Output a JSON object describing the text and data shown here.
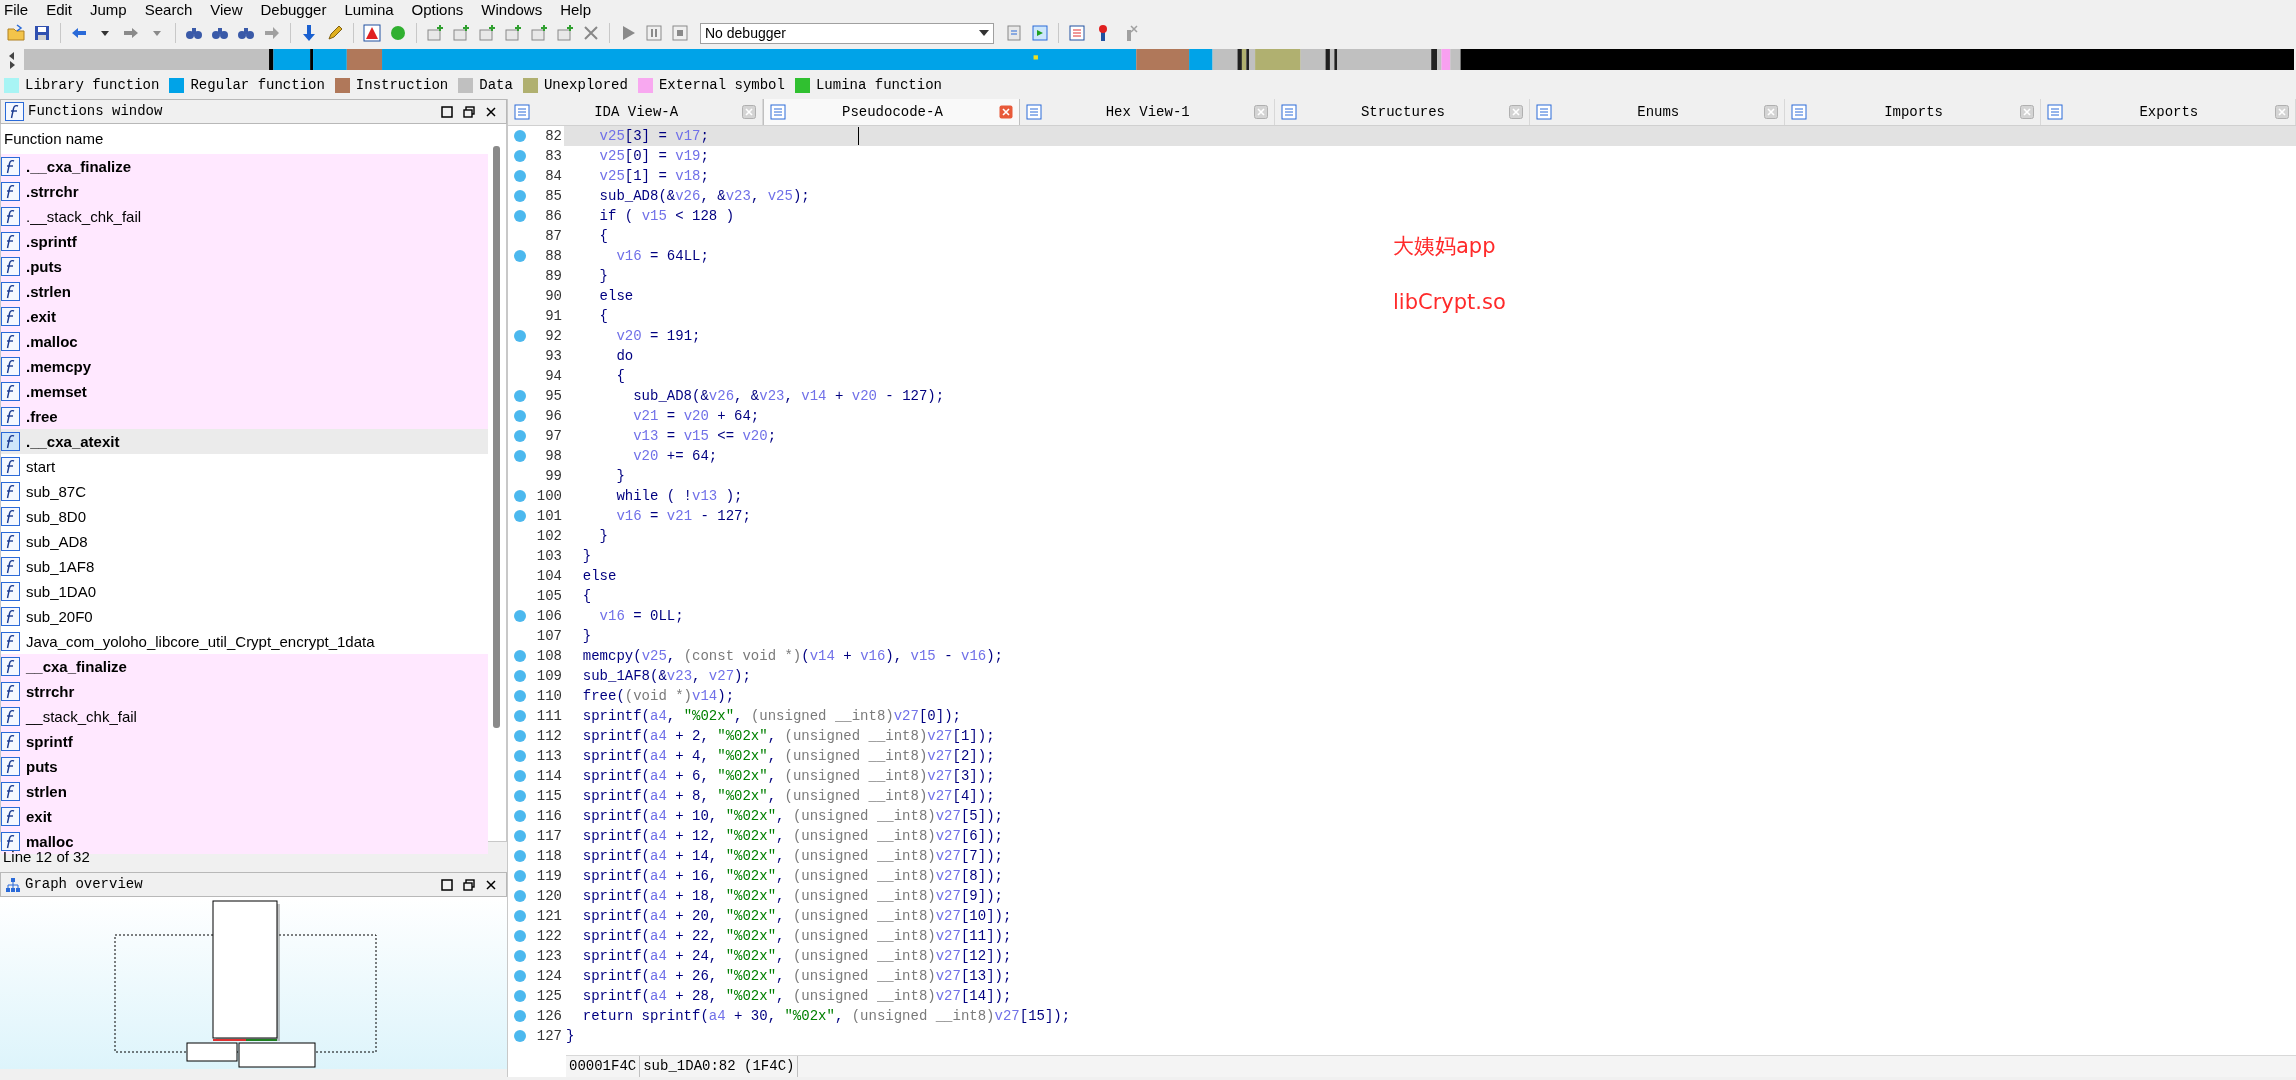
{
  "menu_bar": [
    "File",
    "Edit",
    "Jump",
    "Search",
    "View",
    "Debugger",
    "Lumina",
    "Options",
    "Windows",
    "Help"
  ],
  "toolbar": {
    "debugger": "No debugger"
  },
  "legend": [
    {
      "label": "Library function",
      "color": "#a8f4f4"
    },
    {
      "label": "Regular function",
      "color": "#00a3e8"
    },
    {
      "label": "Instruction",
      "color": "#b0785a"
    },
    {
      "label": "Data",
      "color": "#c0c0c0"
    },
    {
      "label": "Unexplored",
      "color": "#b0b070"
    },
    {
      "label": "External symbol",
      "color": "#f8a8f0"
    },
    {
      "label": "Lumina function",
      "color": "#30c030"
    }
  ],
  "functions_window": {
    "title": "Functions window",
    "column": "Function name",
    "items": [
      {
        "name": ".__cxa_finalize",
        "external": true,
        "bold": true,
        "selected": false
      },
      {
        "name": ".strrchr",
        "external": true,
        "bold": true,
        "selected": false
      },
      {
        "name": ".__stack_chk_fail",
        "external": true,
        "bold": false,
        "selected": false
      },
      {
        "name": ".sprintf",
        "external": true,
        "bold": true,
        "selected": false
      },
      {
        "name": ".puts",
        "external": true,
        "bold": true,
        "selected": false
      },
      {
        "name": ".strlen",
        "external": true,
        "bold": true,
        "selected": false
      },
      {
        "name": ".exit",
        "external": true,
        "bold": true,
        "selected": false
      },
      {
        "name": ".malloc",
        "external": true,
        "bold": true,
        "selected": false
      },
      {
        "name": ".memcpy",
        "external": true,
        "bold": true,
        "selected": false
      },
      {
        "name": ".memset",
        "external": true,
        "bold": true,
        "selected": false
      },
      {
        "name": ".free",
        "external": true,
        "bold": true,
        "selected": false
      },
      {
        "name": ".__cxa_atexit",
        "external": true,
        "bold": true,
        "selected": true
      },
      {
        "name": "start",
        "external": false,
        "bold": false,
        "selected": false
      },
      {
        "name": "sub_87C",
        "external": false,
        "bold": false,
        "selected": false
      },
      {
        "name": "sub_8D0",
        "external": false,
        "bold": false,
        "selected": false
      },
      {
        "name": "sub_AD8",
        "external": false,
        "bold": false,
        "selected": false
      },
      {
        "name": "sub_1AF8",
        "external": false,
        "bold": false,
        "selected": false
      },
      {
        "name": "sub_1DA0",
        "external": false,
        "bold": false,
        "selected": false
      },
      {
        "name": "sub_20F0",
        "external": false,
        "bold": false,
        "selected": false
      },
      {
        "name": "Java_com_yoloho_libcore_util_Crypt_encrypt_1data",
        "external": false,
        "bold": false,
        "selected": false
      },
      {
        "name": "__cxa_finalize",
        "external": true,
        "bold": true,
        "selected": false
      },
      {
        "name": "strrchr",
        "external": true,
        "bold": true,
        "selected": false
      },
      {
        "name": "__stack_chk_fail",
        "external": true,
        "bold": false,
        "selected": false
      },
      {
        "name": "sprintf",
        "external": true,
        "bold": true,
        "selected": false
      },
      {
        "name": "puts",
        "external": true,
        "bold": true,
        "selected": false
      },
      {
        "name": "strlen",
        "external": true,
        "bold": true,
        "selected": false
      },
      {
        "name": "exit",
        "external": true,
        "bold": true,
        "selected": false
      },
      {
        "name": "malloc",
        "external": true,
        "bold": true,
        "selected": false
      }
    ],
    "status": "Line 12 of 32"
  },
  "graph_overview": {
    "title": "Graph overview"
  },
  "tabs": [
    {
      "label": "IDA View-A",
      "selected": false
    },
    {
      "label": "Pseudocode-A",
      "selected": true
    },
    {
      "label": "Hex View-1",
      "selected": false
    },
    {
      "label": "Structures",
      "selected": false
    },
    {
      "label": "Enums",
      "selected": false
    },
    {
      "label": "Imports",
      "selected": false
    },
    {
      "label": "Exports",
      "selected": false
    }
  ],
  "pseudocode": {
    "lines": [
      {
        "number": "82",
        "dot": true,
        "selected": true,
        "segments": [
          {
            "kind": "var",
            "text": "    v25"
          },
          {
            "kind": "plain",
            "text": "[3] = "
          },
          {
            "kind": "var",
            "text": "v17"
          },
          {
            "kind": "plain",
            "text": ";"
          }
        ]
      },
      {
        "number": "83",
        "dot": true,
        "selected": false,
        "segments": [
          {
            "kind": "var",
            "text": "    v25"
          },
          {
            "kind": "plain",
            "text": "[0] = "
          },
          {
            "kind": "var",
            "text": "v19"
          },
          {
            "kind": "plain",
            "text": ";"
          }
        ]
      },
      {
        "number": "84",
        "dot": true,
        "selected": false,
        "segments": [
          {
            "kind": "var",
            "text": "    v25"
          },
          {
            "kind": "plain",
            "text": "[1] = "
          },
          {
            "kind": "var",
            "text": "v18"
          },
          {
            "kind": "plain",
            "text": ";"
          }
        ]
      },
      {
        "number": "85",
        "dot": true,
        "selected": false,
        "segments": [
          {
            "kind": "plain",
            "text": "    sub_AD8(&"
          },
          {
            "kind": "var",
            "text": "v26"
          },
          {
            "kind": "plain",
            "text": ", &"
          },
          {
            "kind": "var",
            "text": "v23"
          },
          {
            "kind": "plain",
            "text": ", "
          },
          {
            "kind": "var",
            "text": "v25"
          },
          {
            "kind": "plain",
            "text": ");"
          }
        ]
      },
      {
        "number": "86",
        "dot": true,
        "selected": false,
        "segments": [
          {
            "kind": "plain",
            "text": "    if ( "
          },
          {
            "kind": "var",
            "text": "v15"
          },
          {
            "kind": "plain",
            "text": " < 128 )"
          }
        ]
      },
      {
        "number": "87",
        "dot": false,
        "selected": false,
        "segments": [
          {
            "kind": "plain",
            "text": "    {"
          }
        ]
      },
      {
        "number": "88",
        "dot": true,
        "selected": false,
        "segments": [
          {
            "kind": "var",
            "text": "      v16"
          },
          {
            "kind": "plain",
            "text": " = 64LL;"
          }
        ]
      },
      {
        "number": "89",
        "dot": false,
        "selected": false,
        "segments": [
          {
            "kind": "plain",
            "text": "    }"
          }
        ]
      },
      {
        "number": "90",
        "dot": false,
        "selected": false,
        "segments": [
          {
            "kind": "plain",
            "text": "    else"
          }
        ]
      },
      {
        "number": "91",
        "dot": false,
        "selected": false,
        "segments": [
          {
            "kind": "plain",
            "text": "    {"
          }
        ]
      },
      {
        "number": "92",
        "dot": true,
        "selected": false,
        "segments": [
          {
            "kind": "var",
            "text": "      v20"
          },
          {
            "kind": "plain",
            "text": " = 191;"
          }
        ]
      },
      {
        "number": "93",
        "dot": false,
        "selected": false,
        "segments": [
          {
            "kind": "plain",
            "text": "      do"
          }
        ]
      },
      {
        "number": "94",
        "dot": false,
        "selected": false,
        "segments": [
          {
            "kind": "plain",
            "text": "      {"
          }
        ]
      },
      {
        "number": "95",
        "dot": true,
        "selected": false,
        "segments": [
          {
            "kind": "plain",
            "text": "        sub_AD8(&"
          },
          {
            "kind": "var",
            "text": "v26"
          },
          {
            "kind": "plain",
            "text": ", &"
          },
          {
            "kind": "var",
            "text": "v23"
          },
          {
            "kind": "plain",
            "text": ", "
          },
          {
            "kind": "var",
            "text": "v14"
          },
          {
            "kind": "plain",
            "text": " + "
          },
          {
            "kind": "var",
            "text": "v20"
          },
          {
            "kind": "plain",
            "text": " - 127);"
          }
        ]
      },
      {
        "number": "96",
        "dot": true,
        "selected": false,
        "segments": [
          {
            "kind": "var",
            "text": "        v21"
          },
          {
            "kind": "plain",
            "text": " = "
          },
          {
            "kind": "var",
            "text": "v20"
          },
          {
            "kind": "plain",
            "text": " + 64;"
          }
        ]
      },
      {
        "number": "97",
        "dot": true,
        "selected": false,
        "segments": [
          {
            "kind": "var",
            "text": "        v13"
          },
          {
            "kind": "plain",
            "text": " = "
          },
          {
            "kind": "var",
            "text": "v15"
          },
          {
            "kind": "plain",
            "text": " <= "
          },
          {
            "kind": "var",
            "text": "v20"
          },
          {
            "kind": "plain",
            "text": ";"
          }
        ]
      },
      {
        "number": "98",
        "dot": true,
        "selected": false,
        "segments": [
          {
            "kind": "var",
            "text": "        v20"
          },
          {
            "kind": "plain",
            "text": " += 64;"
          }
        ]
      },
      {
        "number": "99",
        "dot": false,
        "selected": false,
        "segments": [
          {
            "kind": "plain",
            "text": "      }"
          }
        ]
      },
      {
        "number": "100",
        "dot": true,
        "selected": false,
        "segments": [
          {
            "kind": "plain",
            "text": "      while ( !"
          },
          {
            "kind": "var",
            "text": "v13"
          },
          {
            "kind": "plain",
            "text": " );"
          }
        ]
      },
      {
        "number": "101",
        "dot": true,
        "selected": false,
        "segments": [
          {
            "kind": "var",
            "text": "      v16"
          },
          {
            "kind": "plain",
            "text": " = "
          },
          {
            "kind": "var",
            "text": "v21"
          },
          {
            "kind": "plain",
            "text": " - 127;"
          }
        ]
      },
      {
        "number": "102",
        "dot": false,
        "selected": false,
        "segments": [
          {
            "kind": "plain",
            "text": "    }"
          }
        ]
      },
      {
        "number": "103",
        "dot": false,
        "selected": false,
        "segments": [
          {
            "kind": "plain",
            "text": "  }"
          }
        ]
      },
      {
        "number": "104",
        "dot": false,
        "selected": false,
        "segments": [
          {
            "kind": "plain",
            "text": "  else"
          }
        ]
      },
      {
        "number": "105",
        "dot": false,
        "selected": false,
        "segments": [
          {
            "kind": "plain",
            "text": "  {"
          }
        ]
      },
      {
        "number": "106",
        "dot": true,
        "selected": false,
        "segments": [
          {
            "kind": "var",
            "text": "    v16"
          },
          {
            "kind": "plain",
            "text": " = 0LL;"
          }
        ]
      },
      {
        "number": "107",
        "dot": false,
        "selected": false,
        "segments": [
          {
            "kind": "plain",
            "text": "  }"
          }
        ]
      },
      {
        "number": "108",
        "dot": true,
        "selected": false,
        "segments": [
          {
            "kind": "plain",
            "text": "  memcpy("
          },
          {
            "kind": "var",
            "text": "v25"
          },
          {
            "kind": "plain",
            "text": ", "
          },
          {
            "kind": "cast",
            "text": "(const void *)"
          },
          {
            "kind": "plain",
            "text": "("
          },
          {
            "kind": "var",
            "text": "v14"
          },
          {
            "kind": "plain",
            "text": " + "
          },
          {
            "kind": "var",
            "text": "v16"
          },
          {
            "kind": "plain",
            "text": "), "
          },
          {
            "kind": "var",
            "text": "v15"
          },
          {
            "kind": "plain",
            "text": " - "
          },
          {
            "kind": "var",
            "text": "v16"
          },
          {
            "kind": "plain",
            "text": ");"
          }
        ]
      },
      {
        "number": "109",
        "dot": true,
        "selected": false,
        "segments": [
          {
            "kind": "plain",
            "text": "  sub_1AF8(&"
          },
          {
            "kind": "var",
            "text": "v23"
          },
          {
            "kind": "plain",
            "text": ", "
          },
          {
            "kind": "var",
            "text": "v27"
          },
          {
            "kind": "plain",
            "text": ");"
          }
        ]
      },
      {
        "number": "110",
        "dot": true,
        "selected": false,
        "segments": [
          {
            "kind": "plain",
            "text": "  free("
          },
          {
            "kind": "cast",
            "text": "(void *)"
          },
          {
            "kind": "var",
            "text": "v14"
          },
          {
            "kind": "plain",
            "text": ");"
          }
        ]
      },
      {
        "number": "111",
        "dot": true,
        "selected": false,
        "segments": [
          {
            "kind": "plain",
            "text": "  sprintf("
          },
          {
            "kind": "var",
            "text": "a4"
          },
          {
            "kind": "plain",
            "text": ", "
          },
          {
            "kind": "str",
            "text": "\"%02x\""
          },
          {
            "kind": "plain",
            "text": ", "
          },
          {
            "kind": "cast",
            "text": "(unsigned __int8)"
          },
          {
            "kind": "var",
            "text": "v27"
          },
          {
            "kind": "plain",
            "text": "[0]);"
          }
        ]
      },
      {
        "number": "112",
        "dot": true,
        "selected": false,
        "segments": [
          {
            "kind": "plain",
            "text": "  sprintf("
          },
          {
            "kind": "var",
            "text": "a4"
          },
          {
            "kind": "plain",
            "text": " + 2, "
          },
          {
            "kind": "str",
            "text": "\"%02x\""
          },
          {
            "kind": "plain",
            "text": ", "
          },
          {
            "kind": "cast",
            "text": "(unsigned __int8)"
          },
          {
            "kind": "var",
            "text": "v27"
          },
          {
            "kind": "plain",
            "text": "[1]);"
          }
        ]
      },
      {
        "number": "113",
        "dot": true,
        "selected": false,
        "segments": [
          {
            "kind": "plain",
            "text": "  sprintf("
          },
          {
            "kind": "var",
            "text": "a4"
          },
          {
            "kind": "plain",
            "text": " + 4, "
          },
          {
            "kind": "str",
            "text": "\"%02x\""
          },
          {
            "kind": "plain",
            "text": ", "
          },
          {
            "kind": "cast",
            "text": "(unsigned __int8)"
          },
          {
            "kind": "var",
            "text": "v27"
          },
          {
            "kind": "plain",
            "text": "[2]);"
          }
        ]
      },
      {
        "number": "114",
        "dot": true,
        "selected": false,
        "segments": [
          {
            "kind": "plain",
            "text": "  sprintf("
          },
          {
            "kind": "var",
            "text": "a4"
          },
          {
            "kind": "plain",
            "text": " + 6, "
          },
          {
            "kind": "str",
            "text": "\"%02x\""
          },
          {
            "kind": "plain",
            "text": ", "
          },
          {
            "kind": "cast",
            "text": "(unsigned __int8)"
          },
          {
            "kind": "var",
            "text": "v27"
          },
          {
            "kind": "plain",
            "text": "[3]);"
          }
        ]
      },
      {
        "number": "115",
        "dot": true,
        "selected": false,
        "segments": [
          {
            "kind": "plain",
            "text": "  sprintf("
          },
          {
            "kind": "var",
            "text": "a4"
          },
          {
            "kind": "plain",
            "text": " + 8, "
          },
          {
            "kind": "str",
            "text": "\"%02x\""
          },
          {
            "kind": "plain",
            "text": ", "
          },
          {
            "kind": "cast",
            "text": "(unsigned __int8)"
          },
          {
            "kind": "var",
            "text": "v27"
          },
          {
            "kind": "plain",
            "text": "[4]);"
          }
        ]
      },
      {
        "number": "116",
        "dot": true,
        "selected": false,
        "segments": [
          {
            "kind": "plain",
            "text": "  sprintf("
          },
          {
            "kind": "var",
            "text": "a4"
          },
          {
            "kind": "plain",
            "text": " + 10, "
          },
          {
            "kind": "str",
            "text": "\"%02x\""
          },
          {
            "kind": "plain",
            "text": ", "
          },
          {
            "kind": "cast",
            "text": "(unsigned __int8)"
          },
          {
            "kind": "var",
            "text": "v27"
          },
          {
            "kind": "plain",
            "text": "[5]);"
          }
        ]
      },
      {
        "number": "117",
        "dot": true,
        "selected": false,
        "segments": [
          {
            "kind": "plain",
            "text": "  sprintf("
          },
          {
            "kind": "var",
            "text": "a4"
          },
          {
            "kind": "plain",
            "text": " + 12, "
          },
          {
            "kind": "str",
            "text": "\"%02x\""
          },
          {
            "kind": "plain",
            "text": ", "
          },
          {
            "kind": "cast",
            "text": "(unsigned __int8)"
          },
          {
            "kind": "var",
            "text": "v27"
          },
          {
            "kind": "plain",
            "text": "[6]);"
          }
        ]
      },
      {
        "number": "118",
        "dot": true,
        "selected": false,
        "segments": [
          {
            "kind": "plain",
            "text": "  sprintf("
          },
          {
            "kind": "var",
            "text": "a4"
          },
          {
            "kind": "plain",
            "text": " + 14, "
          },
          {
            "kind": "str",
            "text": "\"%02x\""
          },
          {
            "kind": "plain",
            "text": ", "
          },
          {
            "kind": "cast",
            "text": "(unsigned __int8)"
          },
          {
            "kind": "var",
            "text": "v27"
          },
          {
            "kind": "plain",
            "text": "[7]);"
          }
        ]
      },
      {
        "number": "119",
        "dot": true,
        "selected": false,
        "segments": [
          {
            "kind": "plain",
            "text": "  sprintf("
          },
          {
            "kind": "var",
            "text": "a4"
          },
          {
            "kind": "plain",
            "text": " + 16, "
          },
          {
            "kind": "str",
            "text": "\"%02x\""
          },
          {
            "kind": "plain",
            "text": ", "
          },
          {
            "kind": "cast",
            "text": "(unsigned __int8)"
          },
          {
            "kind": "var",
            "text": "v27"
          },
          {
            "kind": "plain",
            "text": "[8]);"
          }
        ]
      },
      {
        "number": "120",
        "dot": true,
        "selected": false,
        "segments": [
          {
            "kind": "plain",
            "text": "  sprintf("
          },
          {
            "kind": "var",
            "text": "a4"
          },
          {
            "kind": "plain",
            "text": " + 18, "
          },
          {
            "kind": "str",
            "text": "\"%02x\""
          },
          {
            "kind": "plain",
            "text": ", "
          },
          {
            "kind": "cast",
            "text": "(unsigned __int8)"
          },
          {
            "kind": "var",
            "text": "v27"
          },
          {
            "kind": "plain",
            "text": "[9]);"
          }
        ]
      },
      {
        "number": "121",
        "dot": true,
        "selected": false,
        "segments": [
          {
            "kind": "plain",
            "text": "  sprintf("
          },
          {
            "kind": "var",
            "text": "a4"
          },
          {
            "kind": "plain",
            "text": " + 20, "
          },
          {
            "kind": "str",
            "text": "\"%02x\""
          },
          {
            "kind": "plain",
            "text": ", "
          },
          {
            "kind": "cast",
            "text": "(unsigned __int8)"
          },
          {
            "kind": "var",
            "text": "v27"
          },
          {
            "kind": "plain",
            "text": "[10]);"
          }
        ]
      },
      {
        "number": "122",
        "dot": true,
        "selected": false,
        "segments": [
          {
            "kind": "plain",
            "text": "  sprintf("
          },
          {
            "kind": "var",
            "text": "a4"
          },
          {
            "kind": "plain",
            "text": " + 22, "
          },
          {
            "kind": "str",
            "text": "\"%02x\""
          },
          {
            "kind": "plain",
            "text": ", "
          },
          {
            "kind": "cast",
            "text": "(unsigned __int8)"
          },
          {
            "kind": "var",
            "text": "v27"
          },
          {
            "kind": "plain",
            "text": "[11]);"
          }
        ]
      },
      {
        "number": "123",
        "dot": true,
        "selected": false,
        "segments": [
          {
            "kind": "plain",
            "text": "  sprintf("
          },
          {
            "kind": "var",
            "text": "a4"
          },
          {
            "kind": "plain",
            "text": " + 24, "
          },
          {
            "kind": "str",
            "text": "\"%02x\""
          },
          {
            "kind": "plain",
            "text": ", "
          },
          {
            "kind": "cast",
            "text": "(unsigned __int8)"
          },
          {
            "kind": "var",
            "text": "v27"
          },
          {
            "kind": "plain",
            "text": "[12]);"
          }
        ]
      },
      {
        "number": "124",
        "dot": true,
        "selected": false,
        "segments": [
          {
            "kind": "plain",
            "text": "  sprintf("
          },
          {
            "kind": "var",
            "text": "a4"
          },
          {
            "kind": "plain",
            "text": " + 26, "
          },
          {
            "kind": "str",
            "text": "\"%02x\""
          },
          {
            "kind": "plain",
            "text": ", "
          },
          {
            "kind": "cast",
            "text": "(unsigned __int8)"
          },
          {
            "kind": "var",
            "text": "v27"
          },
          {
            "kind": "plain",
            "text": "[13]);"
          }
        ]
      },
      {
        "number": "125",
        "dot": true,
        "selected": false,
        "segments": [
          {
            "kind": "plain",
            "text": "  sprintf("
          },
          {
            "kind": "var",
            "text": "a4"
          },
          {
            "kind": "plain",
            "text": " + 28, "
          },
          {
            "kind": "str",
            "text": "\"%02x\""
          },
          {
            "kind": "plain",
            "text": ", "
          },
          {
            "kind": "cast",
            "text": "(unsigned __int8)"
          },
          {
            "kind": "var",
            "text": "v27"
          },
          {
            "kind": "plain",
            "text": "[14]);"
          }
        ]
      },
      {
        "number": "126",
        "dot": true,
        "selected": false,
        "segments": [
          {
            "kind": "plain",
            "text": "  return sprintf("
          },
          {
            "kind": "var",
            "text": "a4"
          },
          {
            "kind": "plain",
            "text": " + 30, "
          },
          {
            "kind": "str",
            "text": "\"%02x\""
          },
          {
            "kind": "plain",
            "text": ", "
          },
          {
            "kind": "cast",
            "text": "(unsigned __int8)"
          },
          {
            "kind": "var",
            "text": "v27"
          },
          {
            "kind": "plain",
            "text": "[15]);"
          }
        ]
      },
      {
        "number": "127",
        "dot": true,
        "selected": false,
        "segments": [
          {
            "kind": "plain",
            "text": "}"
          }
        ]
      }
    ],
    "status": [
      "00001F4C",
      "sub_1DA0:82 (1F4C)"
    ]
  },
  "annotations": [
    "大姨妈app",
    "libCrypt.so"
  ]
}
